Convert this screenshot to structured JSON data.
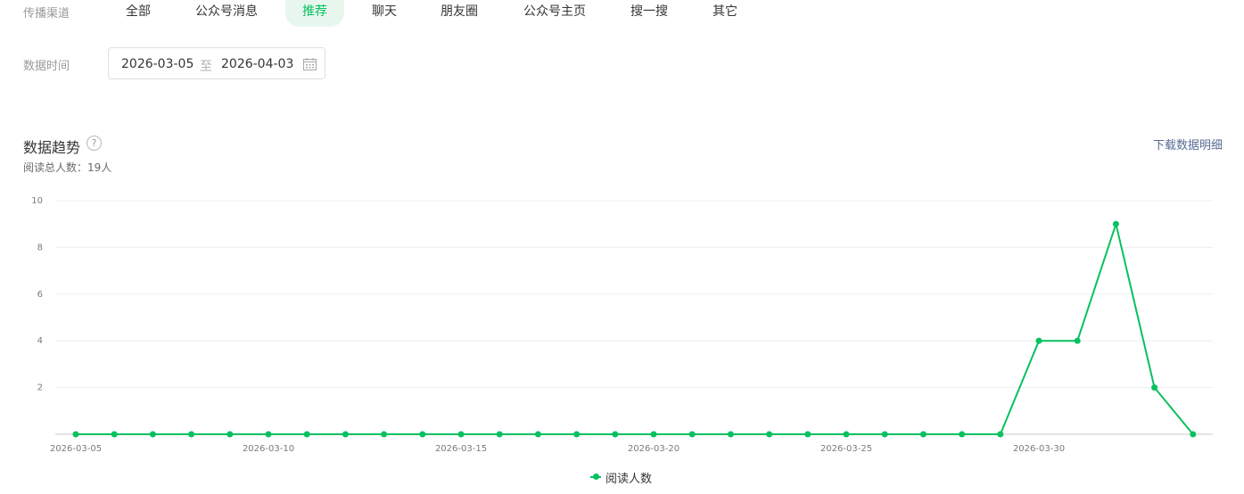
{
  "filters": {
    "channel_label": "传播渠道",
    "channel_tabs": [
      {
        "label": "全部",
        "active": false
      },
      {
        "label": "公众号消息",
        "active": false
      },
      {
        "label": "推荐",
        "active": true
      },
      {
        "label": "聊天",
        "active": false
      },
      {
        "label": "朋友圈",
        "active": false
      },
      {
        "label": "公众号主页",
        "active": false
      },
      {
        "label": "搜一搜",
        "active": false
      },
      {
        "label": "其它",
        "active": false
      }
    ],
    "date_label": "数据时间",
    "date_start": "2026-03-05",
    "date_separator": "至",
    "date_end": "2026-04-03"
  },
  "trend": {
    "title": "数据趋势",
    "help_icon": "question-circle-icon",
    "help_glyph": "?",
    "download_label": "下载数据明细",
    "total_readers": "阅读总人数：19人"
  },
  "chart_data": {
    "type": "line",
    "x": [
      "2026-03-05",
      "2026-03-06",
      "2026-03-07",
      "2026-03-08",
      "2026-03-09",
      "2026-03-10",
      "2026-03-11",
      "2026-03-12",
      "2026-03-13",
      "2026-03-14",
      "2026-03-15",
      "2026-03-16",
      "2026-03-17",
      "2026-03-18",
      "2026-03-19",
      "2026-03-20",
      "2026-03-21",
      "2026-03-22",
      "2026-03-23",
      "2026-03-24",
      "2026-03-25",
      "2026-03-26",
      "2026-03-27",
      "2026-03-28",
      "2026-03-29",
      "2026-03-30",
      "2026-03-31",
      "2026-04-01",
      "2026-04-02",
      "2026-04-03"
    ],
    "x_tick_labels": [
      "2026-03-05",
      "2026-03-10",
      "2026-03-15",
      "2026-03-20",
      "2026-03-25",
      "2026-03-30"
    ],
    "y_ticks": [
      2,
      4,
      6,
      8,
      10
    ],
    "ylim": [
      0,
      10
    ],
    "grid": true,
    "legend_position": "bottom-center",
    "series": [
      {
        "name": "阅读人数",
        "color": "#07c160",
        "values": [
          0,
          0,
          0,
          0,
          0,
          0,
          0,
          0,
          0,
          0,
          0,
          0,
          0,
          0,
          0,
          0,
          0,
          0,
          0,
          0,
          0,
          0,
          0,
          0,
          0,
          4,
          4,
          9,
          2,
          0
        ]
      }
    ]
  }
}
